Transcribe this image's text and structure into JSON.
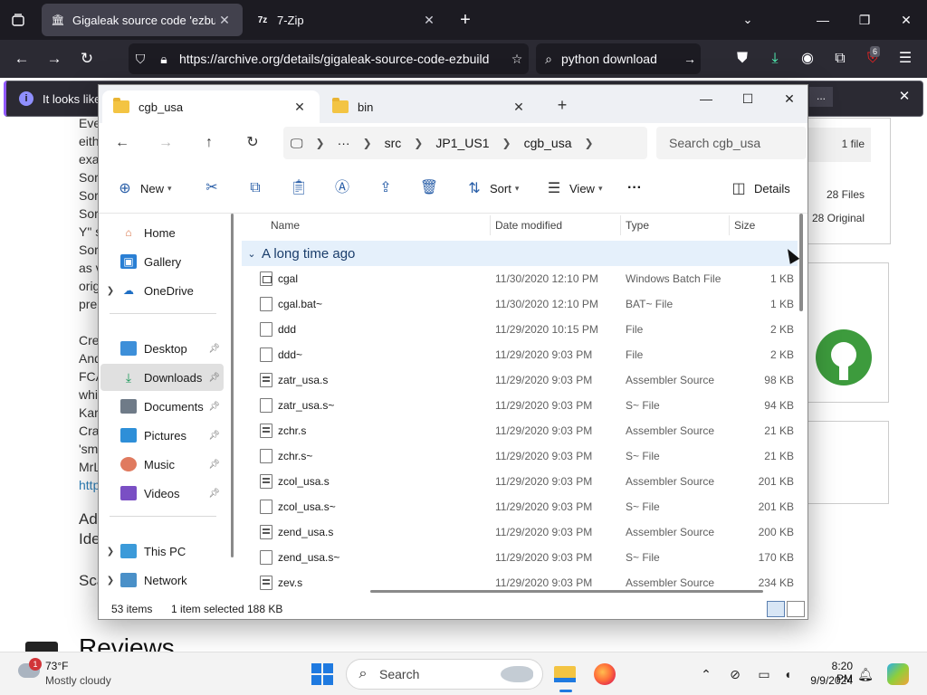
{
  "browser": {
    "tabs": [
      {
        "title": "Gigaleak source code 'ezbuild",
        "active": true
      },
      {
        "title": "7-Zip",
        "active": false
      }
    ],
    "url": "https://archive.org/details/gigaleak-source-code-ezbuild",
    "search_value": "python download",
    "extension_badge": "6",
    "notice_text": "It looks like",
    "notice_more": "...",
    "colors": {
      "chrome_dark": "#1c1b22",
      "toolbar": "#2b2a33",
      "accent": "#9059ff"
    }
  },
  "background_page": {
    "body_lines": [
      "Eve",
      "eith",
      "exa",
      "Sor",
      "Sor",
      "Sor",
      "Y\" s",
      "Sor",
      "as v",
      "orig",
      "pre",
      "",
      "Cre",
      "And",
      "FCA",
      "whi",
      "Kar",
      "Cra",
      "'sm",
      "MrL",
      "http"
    ],
    "heading_1": "Add",
    "heading_1b": "Ide",
    "heading_2": "Sca",
    "reviews_heading": "Reviews",
    "side_panel": {
      "file_count_1": "1 file",
      "file_count_2": "28 Files",
      "file_count_3": "28 Original"
    }
  },
  "explorer": {
    "tabs": [
      {
        "title": "cgb_usa",
        "active": true
      },
      {
        "title": "bin",
        "active": false
      }
    ],
    "breadcrumb": [
      "src",
      "JP1_US1",
      "cgb_usa"
    ],
    "breadcrumb_more": "···",
    "search_placeholder": "Search cgb_usa",
    "toolbar": {
      "new_label": "New",
      "sort_label": "Sort",
      "view_label": "View",
      "more_label": "···",
      "details_label": "Details"
    },
    "nav_pane": {
      "top": [
        {
          "label": "Home",
          "icon": "home-icon"
        },
        {
          "label": "Gallery",
          "icon": "gallery-icon"
        },
        {
          "label": "OneDrive",
          "icon": "cloud-icon"
        }
      ],
      "pinned": [
        {
          "label": "Desktop",
          "icon": "desktop-icon",
          "selected": false
        },
        {
          "label": "Downloads",
          "icon": "download-icon",
          "selected": true
        },
        {
          "label": "Documents",
          "icon": "document-icon",
          "selected": false
        },
        {
          "label": "Pictures",
          "icon": "picture-icon",
          "selected": false
        },
        {
          "label": "Music",
          "icon": "music-icon",
          "selected": false
        },
        {
          "label": "Videos",
          "icon": "video-icon",
          "selected": false
        }
      ],
      "bottom": [
        {
          "label": "This PC",
          "icon": "pc-icon"
        },
        {
          "label": "Network",
          "icon": "network-icon"
        }
      ]
    },
    "columns": [
      "Name",
      "Date modified",
      "Type",
      "Size"
    ],
    "group_label": "A long time ago",
    "files": [
      {
        "name": "cgal",
        "date": "11/30/2020 12:10 PM",
        "type": "Windows Batch File",
        "size": "1 KB",
        "kind": "bat"
      },
      {
        "name": "cgal.bat~",
        "date": "11/30/2020 12:10 PM",
        "type": "BAT~ File",
        "size": "1 KB",
        "kind": "file"
      },
      {
        "name": "ddd",
        "date": "11/29/2020 10:15 PM",
        "type": "File",
        "size": "2 KB",
        "kind": "file"
      },
      {
        "name": "ddd~",
        "date": "11/29/2020 9:03 PM",
        "type": "File",
        "size": "2 KB",
        "kind": "file"
      },
      {
        "name": "zatr_usa.s",
        "date": "11/29/2020 9:03 PM",
        "type": "Assembler Source",
        "size": "98 KB",
        "kind": "asm"
      },
      {
        "name": "zatr_usa.s~",
        "date": "11/29/2020 9:03 PM",
        "type": "S~ File",
        "size": "94 KB",
        "kind": "file"
      },
      {
        "name": "zchr.s",
        "date": "11/29/2020 9:03 PM",
        "type": "Assembler Source",
        "size": "21 KB",
        "kind": "asm"
      },
      {
        "name": "zchr.s~",
        "date": "11/29/2020 9:03 PM",
        "type": "S~ File",
        "size": "21 KB",
        "kind": "file"
      },
      {
        "name": "zcol_usa.s",
        "date": "11/29/2020 9:03 PM",
        "type": "Assembler Source",
        "size": "201 KB",
        "kind": "asm"
      },
      {
        "name": "zcol_usa.s~",
        "date": "11/29/2020 9:03 PM",
        "type": "S~ File",
        "size": "201 KB",
        "kind": "file"
      },
      {
        "name": "zend_usa.s",
        "date": "11/29/2020 9:03 PM",
        "type": "Assembler Source",
        "size": "200 KB",
        "kind": "asm"
      },
      {
        "name": "zend_usa.s~",
        "date": "11/29/2020 9:03 PM",
        "type": "S~ File",
        "size": "170 KB",
        "kind": "file"
      },
      {
        "name": "zev.s",
        "date": "11/29/2020 9:03 PM",
        "type": "Assembler Source",
        "size": "234 KB",
        "kind": "asm"
      }
    ],
    "status": {
      "item_count": "53 items",
      "selection": "1 item selected",
      "selection_size": "188 KB"
    }
  },
  "taskbar": {
    "weather_temp": "73°F",
    "weather_desc": "Mostly cloudy",
    "weather_badge": "1",
    "search_label": "Search",
    "time": "8:20 PM",
    "date": "9/9/2024"
  }
}
